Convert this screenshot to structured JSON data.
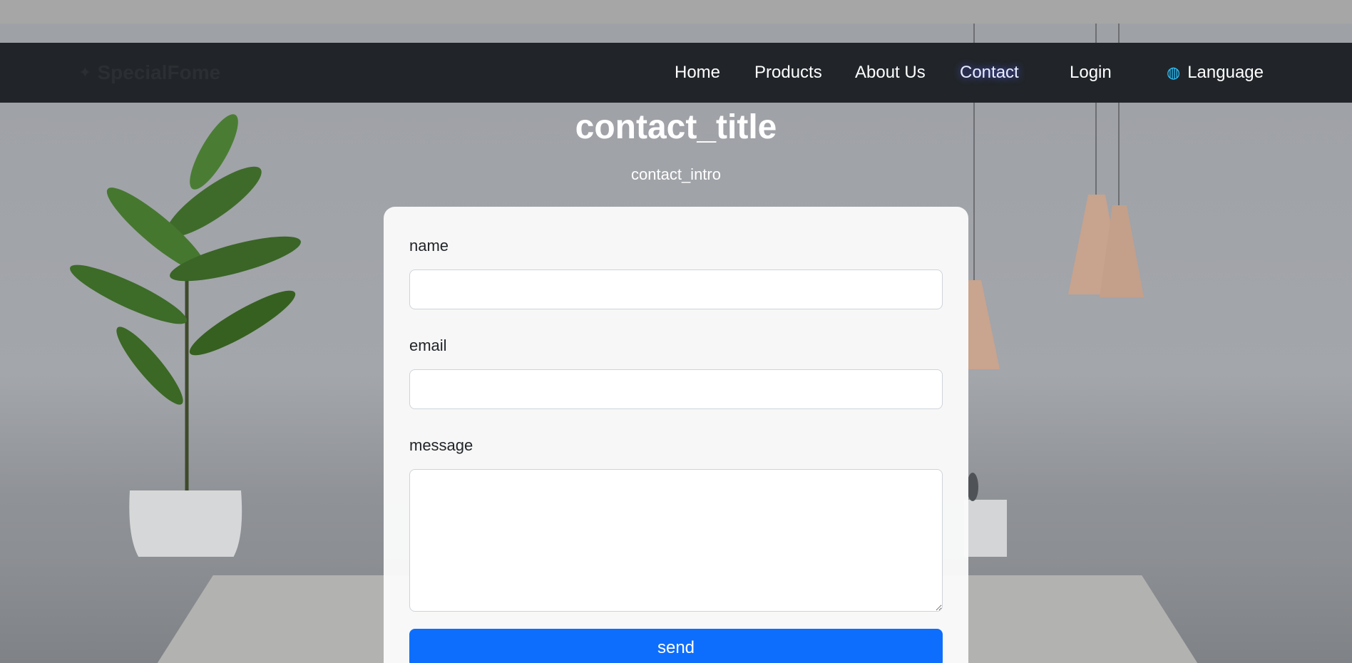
{
  "brand": {
    "name": "SpecialFome",
    "icon": "handshake-icon"
  },
  "nav": {
    "items": [
      {
        "label": "Home"
      },
      {
        "label": "Products"
      },
      {
        "label": "About Us"
      },
      {
        "label": "Contact",
        "active": true
      },
      {
        "label": "Login"
      }
    ],
    "language": {
      "label": "Language",
      "icon": "globe-icon"
    }
  },
  "page": {
    "title": "contact_title",
    "intro": "contact_intro"
  },
  "form": {
    "name_label": "name",
    "name_value": "",
    "email_label": "email",
    "email_value": "",
    "message_label": "message",
    "message_value": "",
    "send_label": "send"
  },
  "colors": {
    "navbar": "#212529",
    "primary": "#0d6efd",
    "card": "#fafafa"
  }
}
